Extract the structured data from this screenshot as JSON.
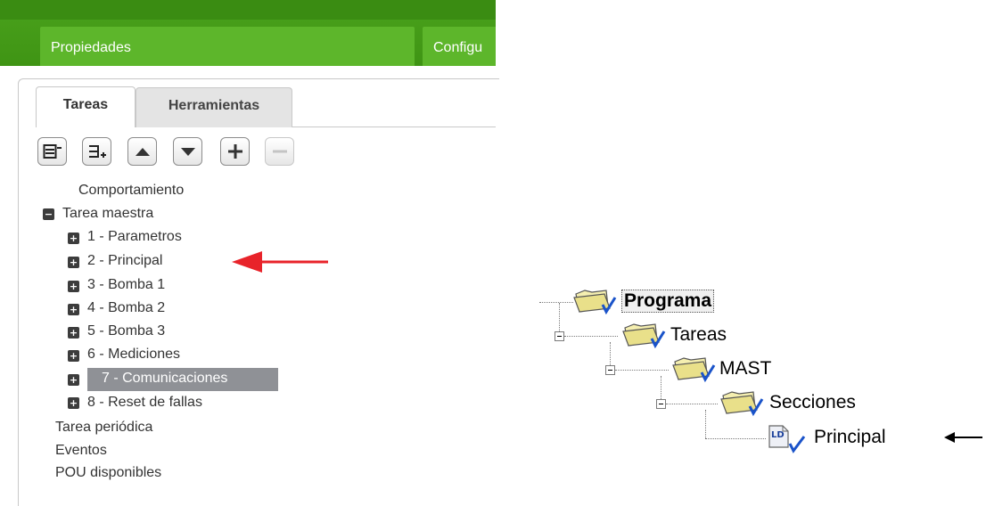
{
  "top_tabs": {
    "properties": "Propiedades",
    "config_partial": "Configu"
  },
  "panel_tabs": {
    "tasks": "Tareas",
    "tools": "Herramientas"
  },
  "tree": {
    "behavior": "Comportamiento",
    "master_task": "Tarea maestra",
    "sections": [
      "1 - Parametros",
      "2 - Principal",
      "3 - Bomba 1",
      "4 - Bomba 2",
      "5 - Bomba 3",
      "6 - Mediciones",
      "7 - Comunicaciones",
      "8 - Reset de fallas"
    ],
    "periodic_task": "Tarea periódica",
    "events": "Eventos",
    "pou_available": "POU disponibles"
  },
  "right_tree": {
    "program": "Programa",
    "tasks": "Tareas",
    "mast": "MAST",
    "sections": "Secciones",
    "ld_badge": "LD",
    "principal": "Principal"
  },
  "colors": {
    "green_bar": "#3f9414",
    "green_tab": "#5db62b",
    "selected_row": "#8f9196",
    "red_arrow": "#e8232a",
    "black_arrow": "#000000"
  }
}
